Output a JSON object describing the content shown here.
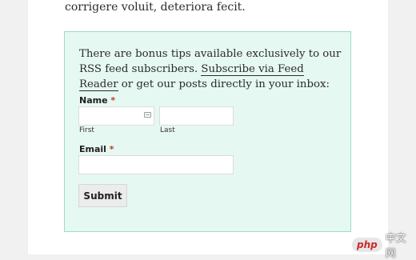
{
  "article": {
    "top_line": "corrigere voluit, deteriora fecit."
  },
  "optin": {
    "intro_before": "There are bonus tips available exclusively to our RSS feed subscribers. ",
    "intro_link": "Subscribe via Feed Reader",
    "intro_after": " or get our posts directly in your inbox:",
    "name_label": "Name",
    "required_mark": "*",
    "first_value": "",
    "first_sublabel": "First",
    "last_value": "",
    "last_sublabel": "Last",
    "email_label": "Email",
    "email_value": "",
    "submit_label": "Submit"
  },
  "watermark": {
    "badge": "php",
    "text": "中文网"
  }
}
